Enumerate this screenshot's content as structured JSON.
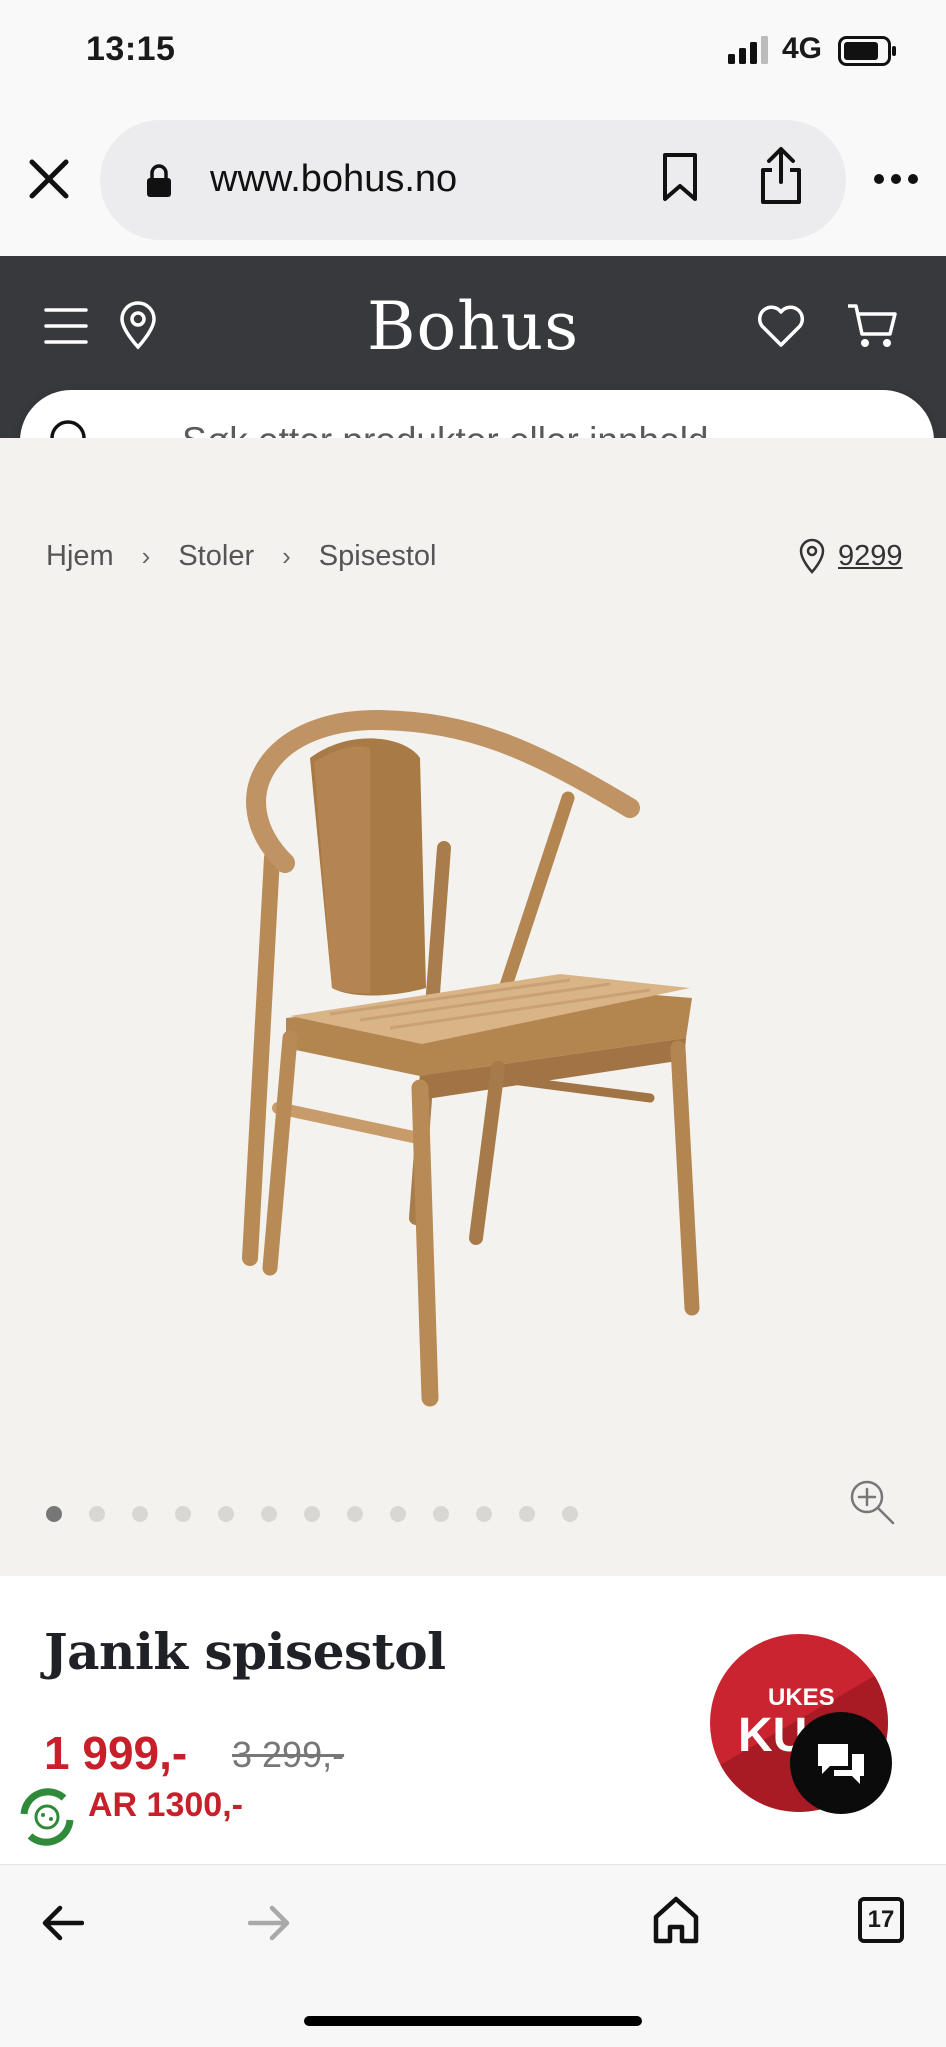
{
  "status_bar": {
    "time": "13:15",
    "network": "4G"
  },
  "browser": {
    "url": "www.bohus.no"
  },
  "site": {
    "logo": "Bohus",
    "search_placeholder": "Søk etter produkter eller innhold..."
  },
  "breadcrumb": [
    "Hjem",
    "Stoler",
    "Spisestol"
  ],
  "store_code": "9299",
  "gallery": {
    "image_count": 13,
    "active_index": 0
  },
  "product": {
    "name": "Janik spisestol",
    "price": "1 999,-",
    "old_price": "3 299,-",
    "savings": "AR 1300,-",
    "badge_line1": "UKES",
    "badge_line2": "KU"
  },
  "toolbar": {
    "tab_count": "17"
  },
  "colors": {
    "header_bg": "#38393c",
    "sale_red": "#c7202b",
    "gallery_bg": "#f4f2ef"
  }
}
